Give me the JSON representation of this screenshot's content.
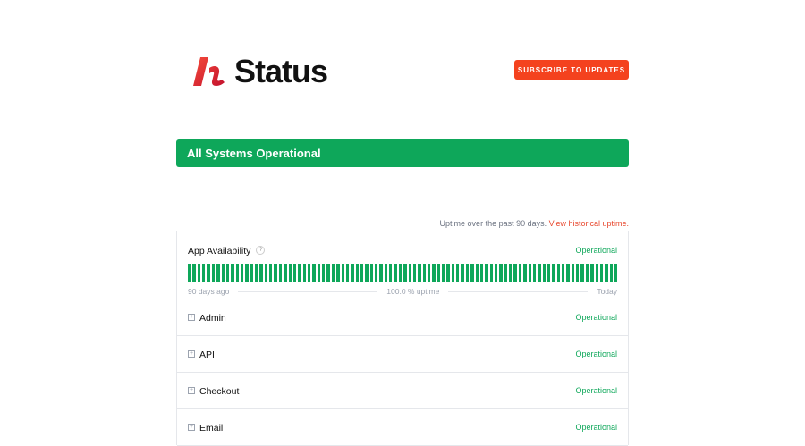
{
  "header": {
    "logo_text": "Status",
    "subscribe_label": "SUBSCRIBE TO UPDATES"
  },
  "banner": {
    "text": "All Systems Operational"
  },
  "uptime_note": {
    "text": "Uptime over the past 90 days.",
    "link": "View historical uptime."
  },
  "main_component": {
    "name": "App Availability",
    "help": "?",
    "status": "Operational",
    "days": 90,
    "left_label": "90 days ago",
    "center_label": "100.0 % uptime",
    "right_label": "Today",
    "bar_color": "#0ea75a"
  },
  "components": [
    {
      "name": "Admin",
      "status": "Operational"
    },
    {
      "name": "API",
      "status": "Operational"
    },
    {
      "name": "Checkout",
      "status": "Operational"
    },
    {
      "name": "Email",
      "status": "Operational"
    }
  ]
}
